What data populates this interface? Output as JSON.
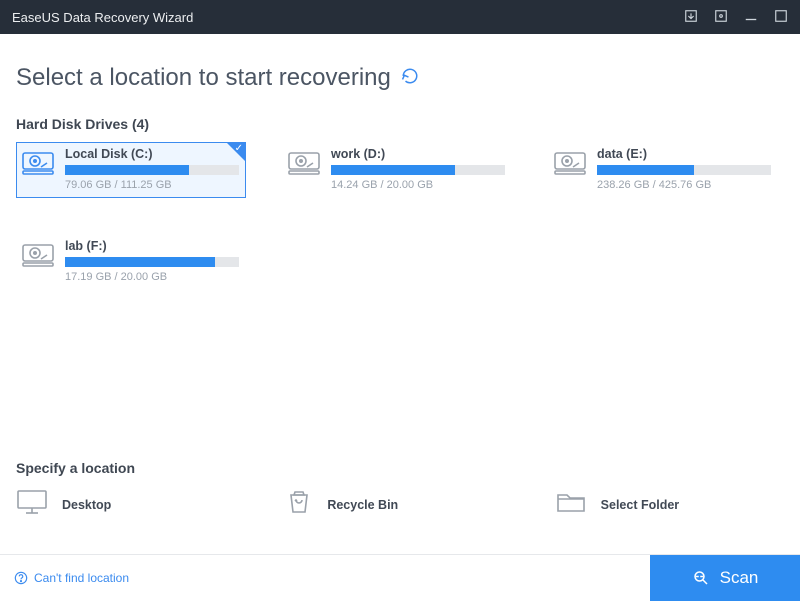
{
  "app": {
    "title": "EaseUS Data Recovery Wizard"
  },
  "headline": "Select a location to start recovering",
  "sections": {
    "hdd_title": "Hard Disk Drives (4)",
    "specify_title": "Specify a location"
  },
  "drives": [
    {
      "name": "Local Disk (C:)",
      "used": 79.06,
      "total": 111.25,
      "size_label": "79.06 GB / 111.25 GB",
      "selected": true
    },
    {
      "name": "work (D:)",
      "used": 14.24,
      "total": 20.0,
      "size_label": "14.24 GB / 20.00 GB",
      "selected": false
    },
    {
      "name": "data (E:)",
      "used": 238.26,
      "total": 425.76,
      "size_label": "238.26 GB / 425.76 GB",
      "selected": false
    },
    {
      "name": "lab (F:)",
      "used": 17.19,
      "total": 20.0,
      "size_label": "17.19 GB / 20.00 GB",
      "selected": false
    }
  ],
  "locations": {
    "desktop": "Desktop",
    "recycle": "Recycle Bin",
    "folder": "Select Folder"
  },
  "footer": {
    "help": "Can't find location",
    "scan": "Scan"
  }
}
